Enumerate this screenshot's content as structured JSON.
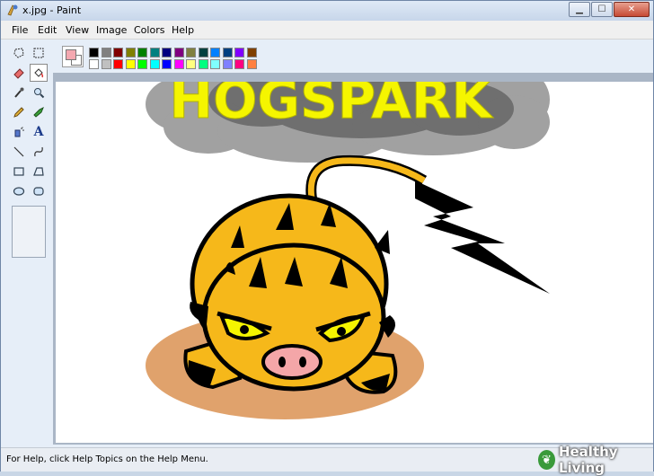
{
  "window": {
    "title": "x.jpg - Paint"
  },
  "menu": [
    {
      "label": "File"
    },
    {
      "label": "Edit"
    },
    {
      "label": "View"
    },
    {
      "label": "Image"
    },
    {
      "label": "Colors"
    },
    {
      "label": "Help"
    }
  ],
  "tools": [
    {
      "name": "free-form-select",
      "icon": "lasso-icon"
    },
    {
      "name": "select",
      "icon": "rect-select-icon"
    },
    {
      "name": "eraser",
      "icon": "eraser-icon"
    },
    {
      "name": "fill",
      "icon": "paint-bucket-icon",
      "selected": true
    },
    {
      "name": "pick-color",
      "icon": "eyedropper-icon"
    },
    {
      "name": "magnifier",
      "icon": "magnifier-icon"
    },
    {
      "name": "pencil",
      "icon": "pencil-icon"
    },
    {
      "name": "brush",
      "icon": "brush-icon"
    },
    {
      "name": "airbrush",
      "icon": "airbrush-icon"
    },
    {
      "name": "text",
      "icon": "text-icon",
      "glyph": "A"
    },
    {
      "name": "line",
      "icon": "line-icon"
    },
    {
      "name": "curve",
      "icon": "curve-icon"
    },
    {
      "name": "rectangle",
      "icon": "rectangle-icon"
    },
    {
      "name": "polygon",
      "icon": "polygon-icon"
    },
    {
      "name": "ellipse",
      "icon": "ellipse-icon"
    },
    {
      "name": "rounded-rectangle",
      "icon": "rounded-rectangle-icon"
    }
  ],
  "colors": {
    "foreground": "#f4a8b0",
    "background": "#ffffff",
    "palette_top": [
      "#000000",
      "#808080",
      "#800000",
      "#808000",
      "#008000",
      "#008080",
      "#000080",
      "#800080",
      "#808040",
      "#004040",
      "#0080ff",
      "#004080",
      "#8000ff",
      "#804000"
    ],
    "palette_bottom": [
      "#ffffff",
      "#c0c0c0",
      "#ff0000",
      "#ffff00",
      "#00ff00",
      "#00ffff",
      "#0000ff",
      "#ff00ff",
      "#ffff80",
      "#00ff80",
      "#80ffff",
      "#8080ff",
      "#ff0080",
      "#ff8040"
    ]
  },
  "canvas": {
    "title_text": "HOGSPARK",
    "title_color": "#f5f500"
  },
  "status": {
    "text": "For Help, click Help Topics on the Help Menu."
  },
  "watermark": {
    "text": "Healthy Living"
  }
}
